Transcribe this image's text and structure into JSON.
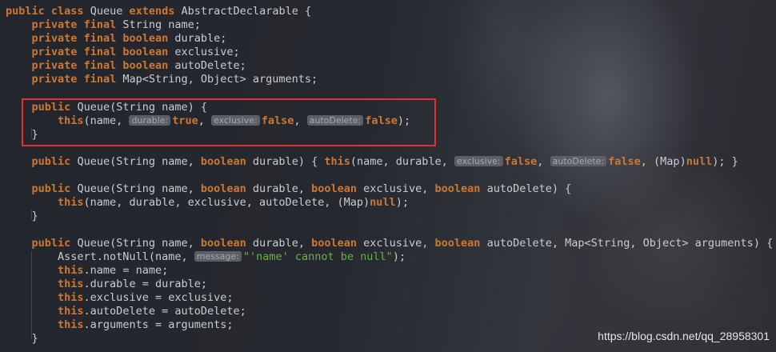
{
  "code": {
    "l1": [
      "public",
      "class",
      "Queue",
      "extends",
      "AbstractDeclarable {"
    ],
    "l2": [
      "private",
      "final",
      "String name;"
    ],
    "l3": [
      "private",
      "final",
      "boolean",
      "durable;"
    ],
    "l4": [
      "private",
      "final",
      "boolean",
      "exclusive;"
    ],
    "l5": [
      "private",
      "final",
      "boolean",
      "autoDelete;"
    ],
    "l6": [
      "private",
      "final",
      "Map<String, Object> arguments;"
    ],
    "c1_sig": [
      "public",
      "Queue(String name) {"
    ],
    "c1_body": [
      "this",
      "(name, ",
      "durable:",
      "true",
      ", ",
      "exclusive:",
      "false",
      ", ",
      "autoDelete:",
      "false",
      ");"
    ],
    "close": "}",
    "c2": [
      "public",
      "Queue(String name, ",
      "boolean",
      "durable) { ",
      "this",
      "(name, durable, ",
      "exclusive:",
      "false",
      ", ",
      "autoDelete:",
      "false",
      ", (Map)",
      "null",
      "); }"
    ],
    "c3_sig": [
      "public",
      "Queue(String name, ",
      "boolean",
      "durable, ",
      "boolean",
      "exclusive, ",
      "boolean",
      "autoDelete) {"
    ],
    "c3_body": [
      "this",
      "(name, durable, exclusive, autoDelete, (Map)",
      "null",
      ");"
    ],
    "c4_sig": [
      "public",
      "Queue(String name, ",
      "boolean",
      "durable, ",
      "boolean",
      "exclusive, ",
      "boolean",
      "autoDelete, Map<String, Object> arguments) {"
    ],
    "c4_assert": [
      "Assert.notNull(name, ",
      "message:",
      "\"'name' cannot be null\"",
      ");"
    ],
    "c4_a1": [
      "this",
      ".name = name;"
    ],
    "c4_a2": [
      "this",
      ".durable = durable;"
    ],
    "c4_a3": [
      "this",
      ".exclusive = exclusive;"
    ],
    "c4_a4": [
      "this",
      ".autoDelete = autoDelete;"
    ],
    "c4_a5": [
      "this",
      ".arguments = arguments;"
    ]
  },
  "watermark": "https://blog.csdn.net/qq_28958301"
}
